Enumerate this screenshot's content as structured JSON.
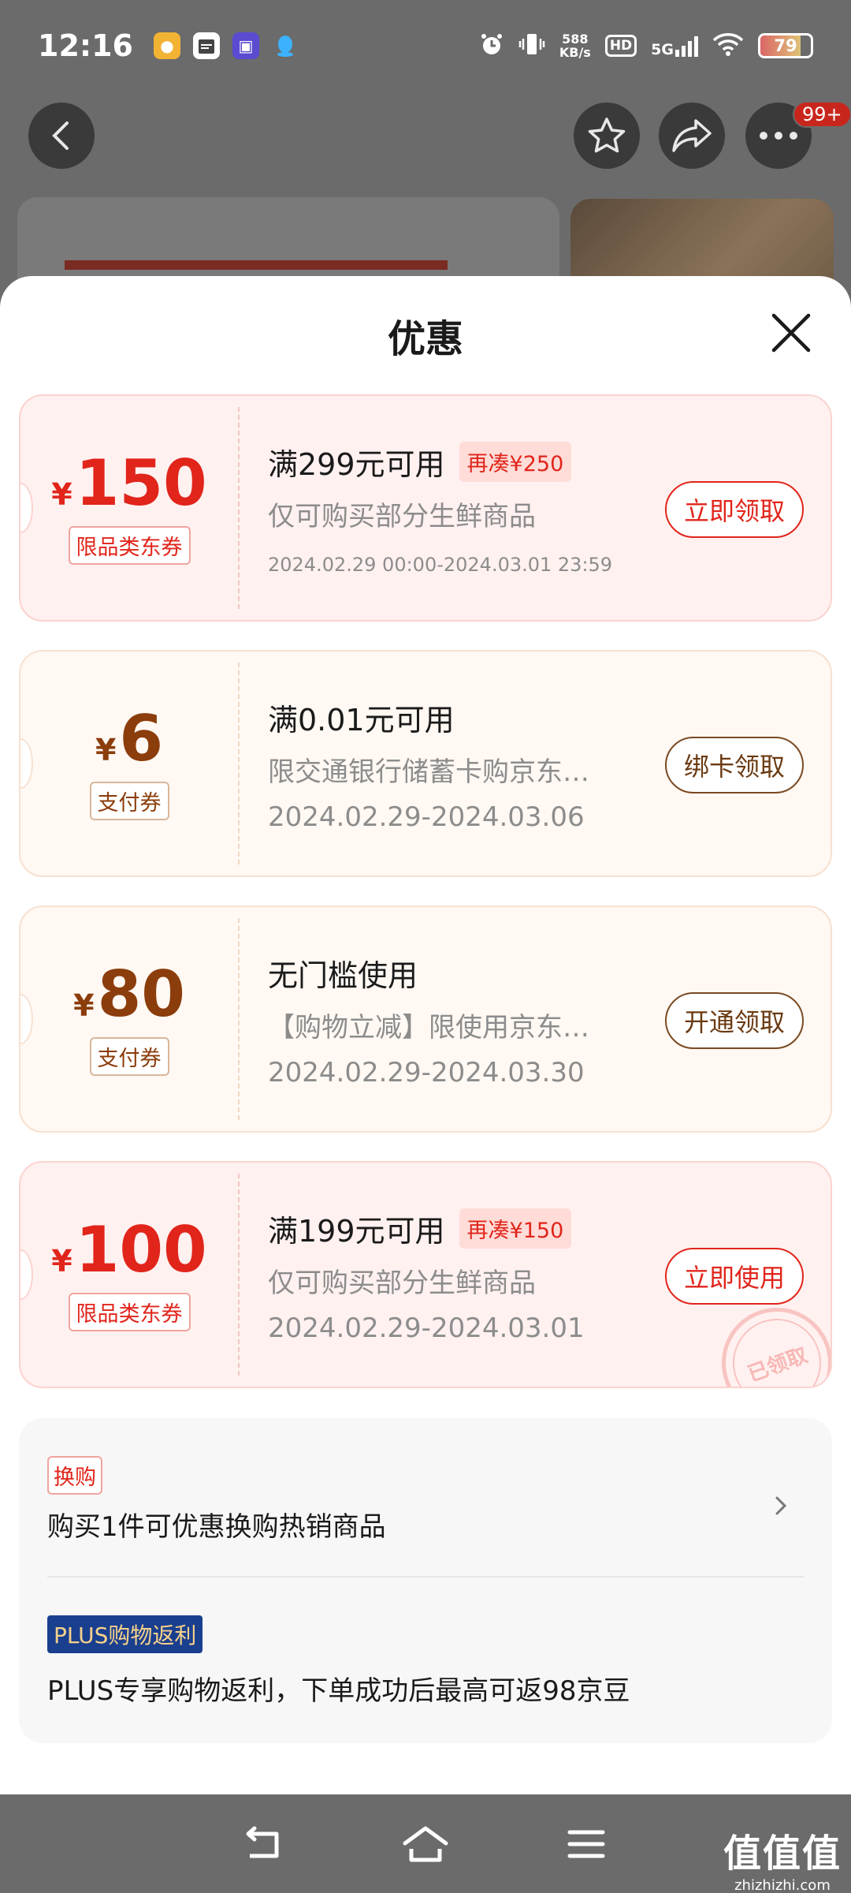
{
  "status_bar": {
    "time": "12:16",
    "speed_value": "588",
    "speed_unit": "KB/s",
    "hd": "HD",
    "network": "5G",
    "battery": "79",
    "battery_level": 0.79,
    "icons": [
      "app-icon-1",
      "calendar-icon",
      "app-icon-2",
      "qq-icon",
      "alarm-icon",
      "vibrate-icon",
      "wifi-icon"
    ]
  },
  "header": {
    "cart_badge": "99+"
  },
  "sheet": {
    "title": "优惠"
  },
  "coupons": [
    {
      "style": "red",
      "currency": "¥",
      "amount": "150",
      "tag": "限品类东券",
      "condition": "满299元可用",
      "extra": "再凑¥250",
      "description": "仅可购买部分生鲜商品",
      "date": "2024.02.29 00:00-2024.03.01 23:59",
      "action": "立即领取"
    },
    {
      "style": "brown",
      "currency": "¥",
      "amount": "6",
      "tag": "支付券",
      "condition": "满0.01元可用",
      "description": "限交通银行储蓄卡购京东…",
      "date": "2024.02.29-2024.03.06",
      "action": "绑卡领取"
    },
    {
      "style": "brown",
      "currency": "¥",
      "amount": "80",
      "tag": "支付券",
      "condition": "无门槛使用",
      "description": "【购物立减】限使用京东…",
      "date": "2024.02.29-2024.03.30",
      "action": "开通领取"
    },
    {
      "style": "red",
      "currency": "¥",
      "amount": "100",
      "tag": "限品类东券",
      "condition": "满199元可用",
      "extra": "再凑¥150",
      "description": "仅可购买部分生鲜商品",
      "date": "2024.02.29-2024.03.01",
      "action": "立即使用",
      "stamp": "已领取"
    }
  ],
  "exchange": {
    "tag": "换购",
    "text": "购买1件可优惠换购热销商品"
  },
  "plus": {
    "tag": "PLUS购物返利",
    "text": "PLUS专享购物返利，下单成功后最高可返98京豆"
  },
  "watermark": {
    "main": "值值值",
    "sub": "zhizhizhi.com"
  },
  "colors": {
    "red": "#e1251b",
    "brown": "#8b3d0b",
    "plus_bg": "#1a3f8f"
  }
}
